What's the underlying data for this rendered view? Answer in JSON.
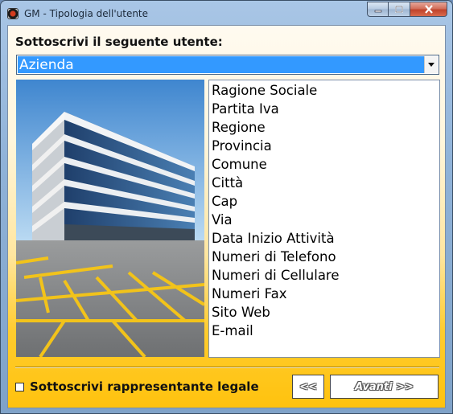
{
  "window": {
    "title": "GM - Tipologia dell'utente",
    "icon": "app-disc-icon",
    "controls": {
      "minimize": "–",
      "maximize": "□",
      "close": "✕"
    }
  },
  "form": {
    "heading": "Sottoscrivi il seguente utente:",
    "user_type_select": {
      "selected": "Azienda"
    },
    "image": "office-building-photo",
    "fields_list": [
      "Ragione Sociale",
      "Partita Iva",
      "Regione",
      "Provincia",
      "Comune",
      "Città",
      "Cap",
      "Via",
      "Data Inizio Attività",
      "Numeri di Telefono",
      "Numeri di Cellulare",
      "Numeri Fax",
      "Sito Web",
      "E-mail"
    ],
    "legal_rep_checkbox": {
      "label": "Sottoscrivi rappresentante legale",
      "checked": false
    },
    "buttons": {
      "back": "<<",
      "next": "Avanti >>"
    }
  },
  "colors": {
    "selection": "#3399ff",
    "background_gradient_end": "#ffc20e"
  }
}
